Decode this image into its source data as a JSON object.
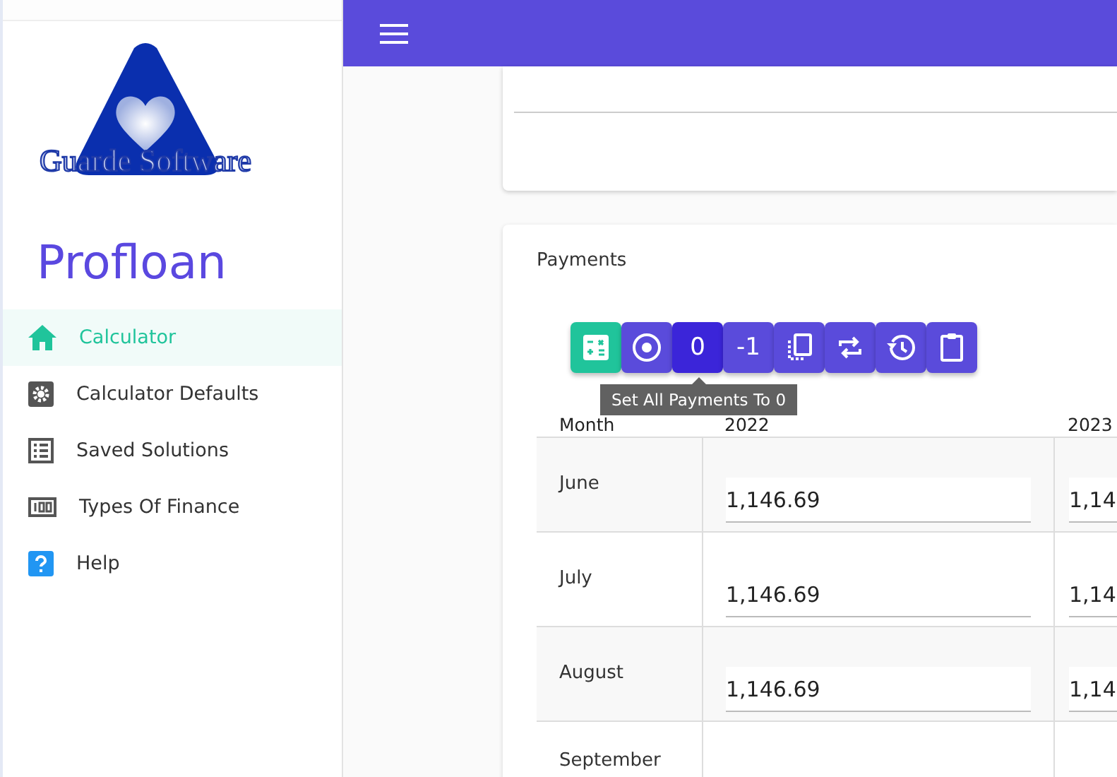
{
  "sidebar": {
    "logo_text": "Guarde Software",
    "app_name": "Profloan",
    "items": [
      {
        "label": "Calculator",
        "selected": true
      },
      {
        "label": "Calculator Defaults",
        "selected": false
      },
      {
        "label": "Saved Solutions",
        "selected": false
      },
      {
        "label": "Types Of Finance",
        "selected": false
      },
      {
        "label": "Help",
        "selected": false
      }
    ]
  },
  "payments": {
    "title": "Payments",
    "toolbar": [
      {
        "kind": "calc",
        "selected": false
      },
      {
        "kind": "target",
        "selected": false
      },
      {
        "kind": "text",
        "label": "0",
        "selected": true
      },
      {
        "kind": "text",
        "label": "-1",
        "selected": false
      },
      {
        "kind": "copy",
        "selected": false
      },
      {
        "kind": "repeat",
        "selected": false
      },
      {
        "kind": "history",
        "selected": false
      },
      {
        "kind": "clipboard",
        "selected": false
      }
    ],
    "tooltip": "Set All Payments To 0",
    "columns": [
      "Month",
      "2022",
      "2023"
    ],
    "rows": [
      {
        "month": "June",
        "values": [
          "1,146.69",
          "1,14"
        ]
      },
      {
        "month": "July",
        "values": [
          "1,146.69",
          "1,14"
        ]
      },
      {
        "month": "August",
        "values": [
          "1,146.69",
          "1,14"
        ]
      },
      {
        "month": "September",
        "values": []
      }
    ]
  }
}
